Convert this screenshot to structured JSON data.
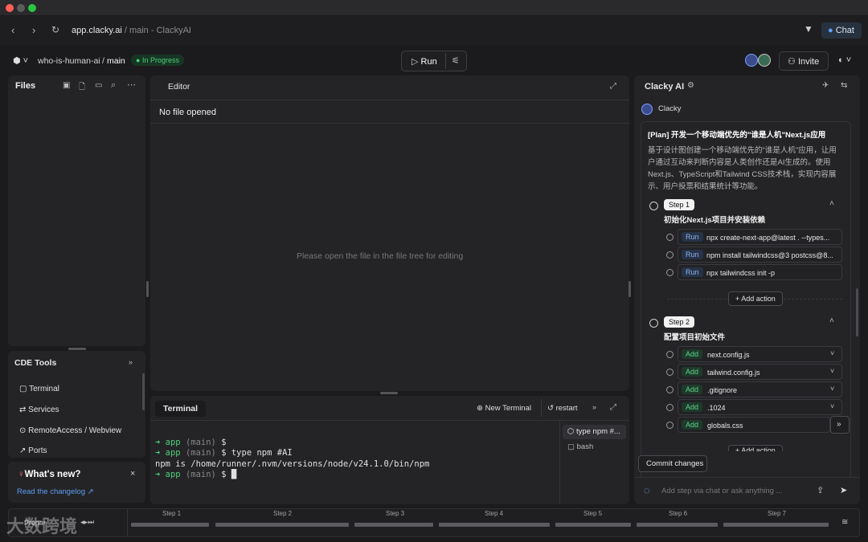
{
  "browser": {
    "url_host": "app.clacky.ai",
    "url_path": " / main - ClackyAI",
    "chat_label": "Chat"
  },
  "header": {
    "project": "who-is-human-ai",
    "branch_sep": "/",
    "branch": "main",
    "status": "In Progress",
    "run_label": "Run",
    "invite_label": "Invite"
  },
  "files": {
    "title": "Files"
  },
  "editor": {
    "tab": "Editor",
    "no_file": "No file opened",
    "placeholder": "Please open the file in the file tree for editing"
  },
  "cde_tools": {
    "title": "CDE Tools",
    "items": [
      "Terminal",
      "Services",
      "RemoteAccess / Webview",
      "Ports"
    ]
  },
  "whats_new": {
    "title": "What's new?",
    "link": "Read the changelog ↗"
  },
  "terminal": {
    "tab": "Terminal",
    "new_terminal": "New Terminal",
    "restart": "restart",
    "lines": [
      {
        "arrow": "➜ ",
        "app": "app ",
        "branch": "(main) ",
        "rest": "$"
      },
      {
        "arrow": "➜ ",
        "app": "app ",
        "branch": "(main) ",
        "rest": "$ type npm #AI"
      },
      {
        "arrow": "",
        "app": "",
        "branch": "",
        "rest": "npm is /home/runner/.nvm/versions/node/v24.1.0/bin/npm"
      },
      {
        "arrow": "➜ ",
        "app": "app ",
        "branch": "(main) ",
        "rest": "$ █"
      }
    ],
    "sessions": [
      "type npm #...",
      "bash"
    ]
  },
  "ai": {
    "title": "Clacky AI",
    "agent": "Clacky",
    "plan_title": "[Plan] 开发一个移动端优先的\"谁是人机\"Next.js应用",
    "plan_desc": "基于设计图创建一个移动端优先的\"谁是人机\"应用，让用户通过互动来判断内容是人类创作还是AI生成的。使用Next.js、TypeScript和Tailwind CSS技术栈，实现内容展示、用户投票和结果统计等功能。",
    "step1": {
      "badge": "Step 1",
      "title": "初始化Next.js项目并安装依赖",
      "actions": [
        {
          "tag": "Run",
          "text": "npx create-next-app@latest . --types..."
        },
        {
          "tag": "Run",
          "text": "npm install tailwindcss@3 postcss@8..."
        },
        {
          "tag": "Run",
          "text": "npx tailwindcss init -p"
        }
      ],
      "add_action": "+ Add action"
    },
    "step2": {
      "badge": "Step 2",
      "title": "配置项目初始文件",
      "actions": [
        {
          "tag": "Add",
          "text": "next.config.js"
        },
        {
          "tag": "Add",
          "text": "tailwind.config.js"
        },
        {
          "tag": "Add",
          "text": ".gitignore"
        },
        {
          "tag": "Add",
          "text": ".1024"
        },
        {
          "tag": "Add",
          "text": "globals.css"
        }
      ],
      "add_action": "+ Add action"
    },
    "commit": "Commit changes",
    "input_placeholder": "Add step via chat or ask anything ..."
  },
  "timeline": {
    "left_label": "Prepar",
    "steps": [
      "Step 1",
      "Step 2",
      "Step 3",
      "Step 4",
      "Step 5",
      "Step 6",
      "Step 7"
    ]
  },
  "watermark": "大数跨境",
  "colors": {
    "accent_green": "#4fce77",
    "run_tag": "#8fb0e8",
    "link_blue": "#5c9ef0"
  }
}
